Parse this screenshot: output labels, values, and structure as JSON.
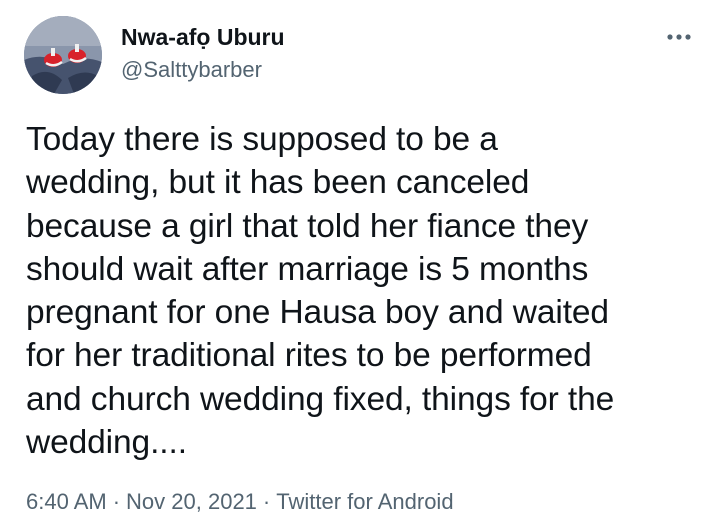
{
  "tweet": {
    "author": {
      "name": "Nwa-afọ Uburu",
      "handle": "@Salttybarber",
      "avatar_icon": "profile-photo-red-sneakers"
    },
    "more_icon": "more-options-dots-icon",
    "text": "Today there is supposed to be a\nwedding, but it has been canceled\nbecause a girl that told her fiance they\nshould wait after marriage is 5 months\npregnant for one Hausa boy and waited\nfor her traditional rites to be performed\nand church wedding fixed, things for the\nwedding....",
    "time": "6:40 AM",
    "separator": "·",
    "date": "Nov 20, 2021",
    "source": "Twitter for Android"
  },
  "colors": {
    "text": "#0f1419",
    "secondary": "#536471",
    "background": "#ffffff"
  }
}
